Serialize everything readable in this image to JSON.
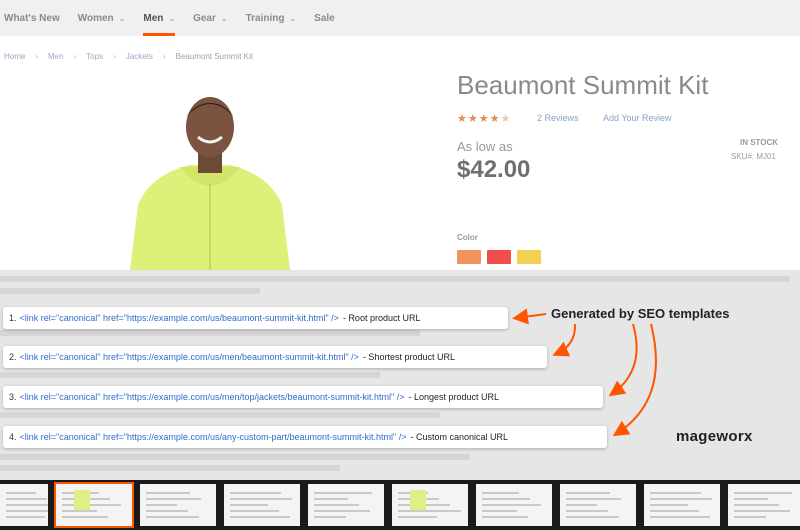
{
  "nav": {
    "items": [
      {
        "label": "What's New",
        "dropdown": false,
        "active": false
      },
      {
        "label": "Women",
        "dropdown": true,
        "active": false
      },
      {
        "label": "Men",
        "dropdown": true,
        "active": true
      },
      {
        "label": "Gear",
        "dropdown": true,
        "active": false
      },
      {
        "label": "Training",
        "dropdown": true,
        "active": false
      },
      {
        "label": "Sale",
        "dropdown": false,
        "active": false
      }
    ]
  },
  "breadcrumb": [
    "Home",
    "Men",
    "Tops",
    "Jackets",
    "Beaumont Summit Kit"
  ],
  "product": {
    "title": "Beaumont Summit Kit",
    "rating_stars": 4.5,
    "reviews": "2  Reviews",
    "add_review": "Add Your Review",
    "as_low_as": "As low as",
    "price": "$42.00",
    "stock": "IN STOCK",
    "sku": "SKU#:  MJ01",
    "color_label": "Color",
    "swatches": [
      "#f0935e",
      "#ef4f4a",
      "#f2d152"
    ]
  },
  "canonicals": [
    {
      "num": "1.",
      "code": "<link  rel=\"canonical\" href=\"https://example.com/us/beaumont-summit-kit.html\" />",
      "desc": "- Root product URL"
    },
    {
      "num": "2.",
      "code": "<link  rel=\"canonical\" href=\"https://example.com/us/men/beaumont-summit-kit.html\" />",
      "desc": "- Shortest product URL"
    },
    {
      "num": "3.",
      "code": "<link  rel=\"canonical\" href=\"https://example.com/us/men/top/jackets/beaumont-summit-kit.html\" />",
      "desc": "- Longest product URL"
    },
    {
      "num": "4.",
      "code": "<link  rel=\"canonical\" href=\"https://example.com/us/any-custom-part/beaumont-summit-kit.html\" />",
      "desc": "- Custom canonical URL"
    }
  ],
  "callout": "Generated by SEO templates",
  "logo": "mageworx",
  "colors": {
    "accent": "#ff5501",
    "link": "#2f6dcc",
    "arrow": "#ff5501"
  },
  "thumbnails_count": 10
}
